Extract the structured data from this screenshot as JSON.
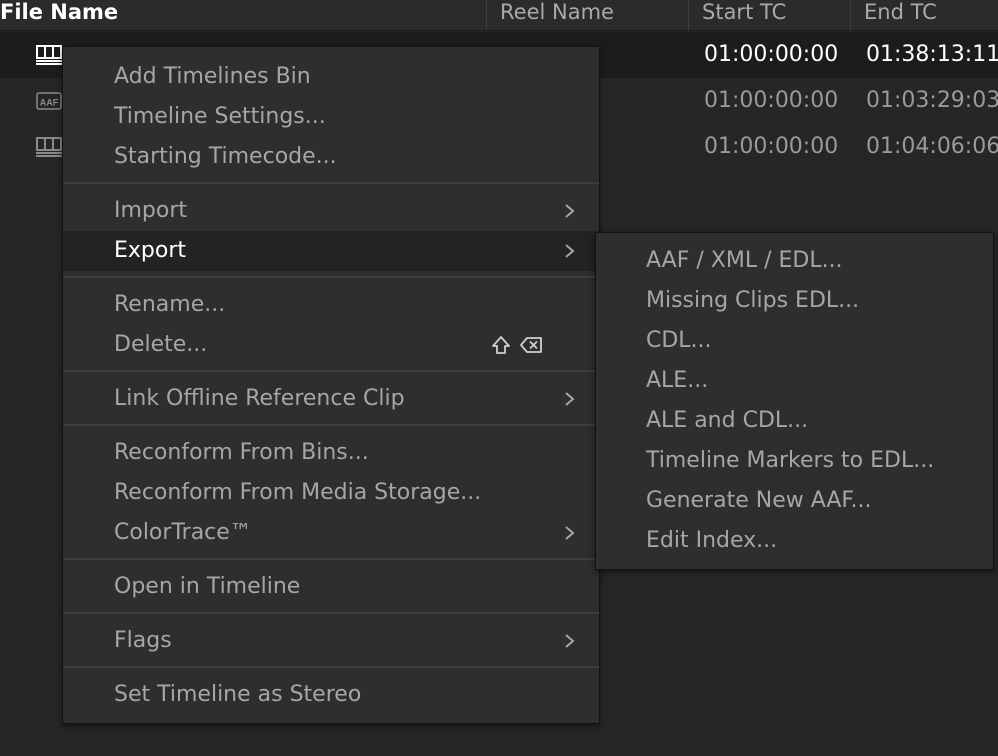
{
  "header": {
    "file_name": "File Name",
    "reel_name": "Reel Name",
    "start_tc": "Start TC",
    "end_tc": "End TC"
  },
  "rows": [
    {
      "icon": "timeline-icon",
      "start_tc": "01:00:00:00",
      "end_tc": "01:38:13:11",
      "selected": true
    },
    {
      "icon": "aaf-icon",
      "icon_text": "AAF",
      "start_tc": "01:00:00:00",
      "end_tc": "01:03:29:03",
      "selected": false
    },
    {
      "icon": "timeline-icon",
      "start_tc": "01:00:00:00",
      "end_tc": "01:04:06:06",
      "selected": false
    }
  ],
  "context_menu": {
    "items": [
      {
        "label": "Add Timelines Bin"
      },
      {
        "label": "Timeline Settings..."
      },
      {
        "label": "Starting Timecode..."
      },
      {
        "label": "Import",
        "submenu": true
      },
      {
        "label": "Export",
        "submenu": true,
        "active": true
      },
      {
        "label": "Rename..."
      },
      {
        "label": "Delete...",
        "shortcut_icon": "shift-delete-icon"
      },
      {
        "label": "Link Offline Reference Clip",
        "submenu": true
      },
      {
        "label": "Reconform From Bins..."
      },
      {
        "label": "Reconform From Media Storage..."
      },
      {
        "label": "ColorTrace™",
        "submenu": true
      },
      {
        "label": "Open in Timeline"
      },
      {
        "label": "Flags",
        "submenu": true
      },
      {
        "label": "Set Timeline as Stereo"
      }
    ]
  },
  "export_submenu": {
    "items": [
      {
        "label": "AAF / XML / EDL..."
      },
      {
        "label": "Missing Clips EDL..."
      },
      {
        "label": "CDL..."
      },
      {
        "label": "ALE..."
      },
      {
        "label": "ALE and CDL..."
      },
      {
        "label": "Timeline Markers to EDL..."
      },
      {
        "label": "Generate New AAF..."
      },
      {
        "label": "Edit Index..."
      }
    ]
  },
  "colors": {
    "background": "#262628",
    "menu_background": "#2e2e30",
    "menu_text": "#a6a6a8",
    "active_text": "#ffffff"
  }
}
